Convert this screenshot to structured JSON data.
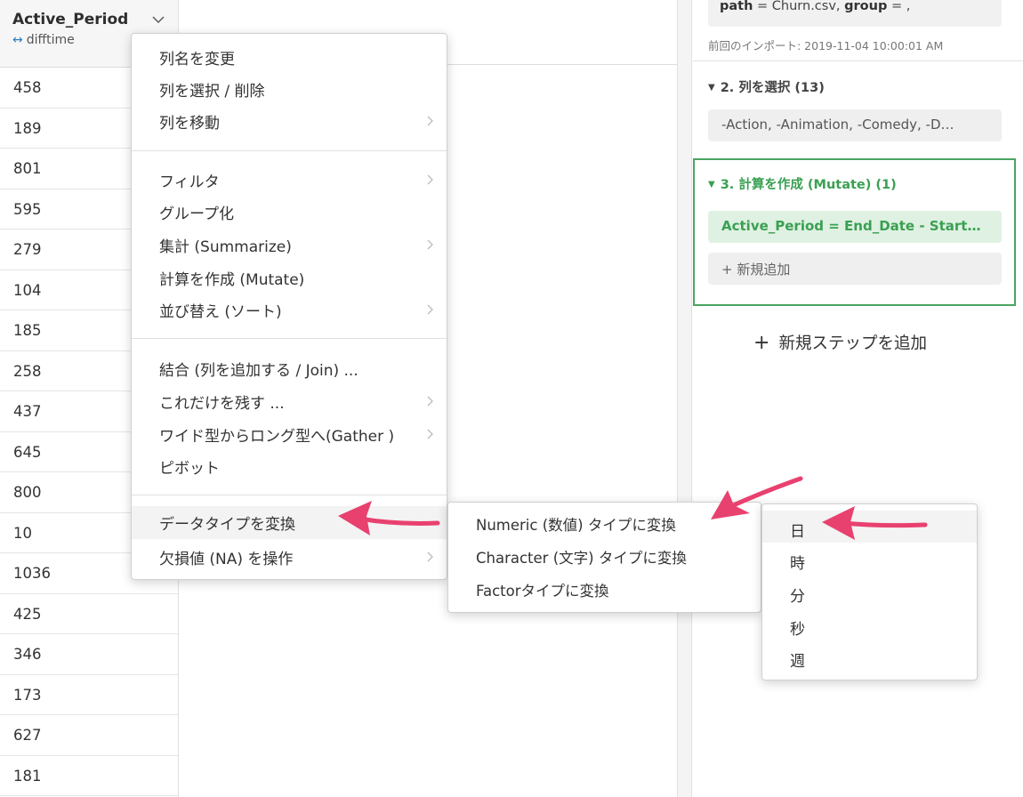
{
  "column": {
    "title": "Active_Period",
    "type_icon": "double-arrow-icon",
    "type_label": "difftime",
    "rows": [
      "458",
      "189",
      "801",
      "595",
      "279",
      "104",
      "185",
      "258",
      "437",
      "645",
      "800",
      "10",
      "1036",
      "425",
      "346",
      "173",
      "627",
      "181"
    ]
  },
  "panel": {
    "source_path_key": "path",
    "source_path_value": " = Churn.csv, ",
    "source_group_key": "group",
    "source_group_value": " = ,",
    "last_import": "前回のインポート: 2019-11-04 10:00:01 AM",
    "step2": {
      "title": "2. 列を選択 (13)",
      "content": "-Action, -Animation, -Comedy, -D…"
    },
    "step3": {
      "title": "3. 計算を作成 (Mutate) (1)",
      "content": "Active_Period = End_Date - Start…",
      "add_label": "+ 新規追加"
    },
    "add_step": "新規ステップを追加"
  },
  "context_menu": {
    "items": [
      {
        "label": "列名を変更",
        "submenu": false
      },
      {
        "label": "列を選択 / 削除",
        "submenu": false
      },
      {
        "label": "列を移動",
        "submenu": true
      },
      {
        "label": "フィルタ",
        "submenu": true
      },
      {
        "label": "グループ化",
        "submenu": false
      },
      {
        "label": "集計 (Summarize)",
        "submenu": true
      },
      {
        "label": "計算を作成 (Mutate)",
        "submenu": false
      },
      {
        "label": "並び替え (ソート)",
        "submenu": true
      },
      {
        "label": "結合 (列を追加する / Join) ...",
        "submenu": false
      },
      {
        "label": "これだけを残す ...",
        "submenu": true
      },
      {
        "label": "ワイド型からロング型へ(Gather )",
        "submenu": true
      },
      {
        "label": "ピボット",
        "submenu": false
      },
      {
        "label": "データタイプを変換",
        "submenu": false
      },
      {
        "label": "欠損値 (NA) を操作",
        "submenu": true
      }
    ]
  },
  "convert_submenu": {
    "items": [
      "Numeric (数値) タイプに変換",
      "Character (文字) タイプに変換",
      "Factorタイプに変換"
    ]
  },
  "unit_submenu": {
    "items": [
      "日",
      "時",
      "分",
      "秒",
      "週"
    ]
  },
  "colors": {
    "accent_green": "#4aa563",
    "annotation_arrow": "#e8416f",
    "link_blue": "#2f7fc1"
  }
}
